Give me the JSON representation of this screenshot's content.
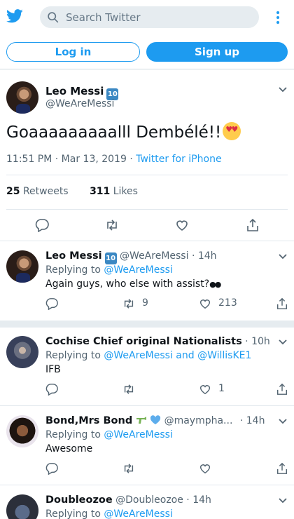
{
  "header": {
    "search_placeholder": "Search Twitter",
    "login_label": "Log in",
    "signup_label": "Sign up"
  },
  "tweet": {
    "author_name": "Leo Messi",
    "author_badge": "10",
    "author_handle": "@WeAreMessi",
    "text": "Goaaaaaaaaalll Dembélé!!",
    "time": "11:51 PM · Mar 13, 2019 · ",
    "source": "Twitter for iPhone",
    "retweets_count": "25",
    "retweets_label": "Retweets",
    "likes_count": "311",
    "likes_label": "Likes"
  },
  "replies": [
    {
      "name": "Leo Messi",
      "badge": "10",
      "handle": "@WeAreMessi",
      "time": " · 14h",
      "replying_prefix": "Replying to ",
      "replying_to": "@WeAreMessi",
      "text": "Again guys, who else with assist?",
      "retweets": "9",
      "likes": "213"
    },
    {
      "name": "Cochise Chief original Nationalists",
      "time": " · 10h",
      "replying_prefix": "Replying to ",
      "replying_to": "@WeAreMessi and @WillisKE1",
      "text": "IFB",
      "retweets": "",
      "likes": "1"
    },
    {
      "name": "Bond,Mrs Bond",
      "handle": "@maympha...",
      "time": " · 14h",
      "replying_prefix": "Replying to ",
      "replying_to": "@WeAreMessi",
      "text": "Awesome",
      "retweets": "",
      "likes": ""
    },
    {
      "name": "Doubleozoe",
      "handle": "@Doubleozoe",
      "time": " · 14h",
      "replying_prefix": "Replying to ",
      "replying_to": "@WeAreMessi"
    }
  ],
  "colors": {
    "accent": "#1d9bf0",
    "text": "#0f1419",
    "secondary": "#536471"
  }
}
